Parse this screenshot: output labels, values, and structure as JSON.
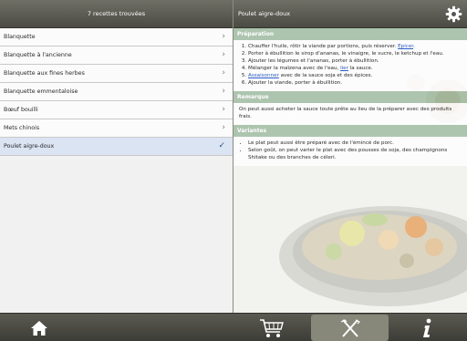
{
  "list_header": {
    "count_label": "7 recettes trouvées"
  },
  "detail_header": {
    "title": "Poulet aigre-doux"
  },
  "recipes": [
    {
      "label": "Blanquette"
    },
    {
      "label": "Blanquette à l'ancienne"
    },
    {
      "label": "Blanquette aux fines herbes"
    },
    {
      "label": "Blanquette emmentaloise"
    },
    {
      "label": "Bœuf bouilli"
    },
    {
      "label": "Mets chinois"
    },
    {
      "label": "Poulet aigre-doux"
    }
  ],
  "sections": {
    "preparation": {
      "title": "Préparation",
      "steps": [
        {
          "text": "Chauffer l'huile, rôtir la viande par portions, puis réserver. ",
          "link": "Epicer",
          "after": "."
        },
        {
          "text": "Porter à ébullition le sirop d'ananas, le vinaigre, le sucre, le ketchup et l'eau.",
          "link": "",
          "after": ""
        },
        {
          "text": "Ajouter les légumes et l'ananas, porter à ébullition.",
          "link": "",
          "after": ""
        },
        {
          "text": "Mélanger la maïzena avec de l'eau, ",
          "link": "lier",
          "after": " la sauce."
        },
        {
          "text": "",
          "link": "Assaisonner",
          "after": " avec de la sauce soja et des épices."
        },
        {
          "text": "Ajouter la viande, porter à ébullition.",
          "link": "",
          "after": ""
        }
      ]
    },
    "remarque": {
      "title": "Remarque",
      "text": "On peut aussi acheter la sauce toute prête au lieu de la préparer avec des produits frais."
    },
    "variantes": {
      "title": "Variantes",
      "items": [
        "Le plat peut aussi être préparé avec de l'émincé de porc.",
        "Selon goût, on peut varier le plat avec des pousses de soja, des champignons Shitake ou des branches de céleri."
      ]
    }
  },
  "toolbar": {
    "icons": [
      "home-icon",
      "shopping-cart-icon",
      "cutlery-icon",
      "info-icon"
    ],
    "active": "cutlery-icon"
  },
  "colors": {
    "header": "#5e5e56",
    "section_head": "#82aa87",
    "selected_row": "#dbe4f3",
    "link": "#2a5cc9"
  }
}
